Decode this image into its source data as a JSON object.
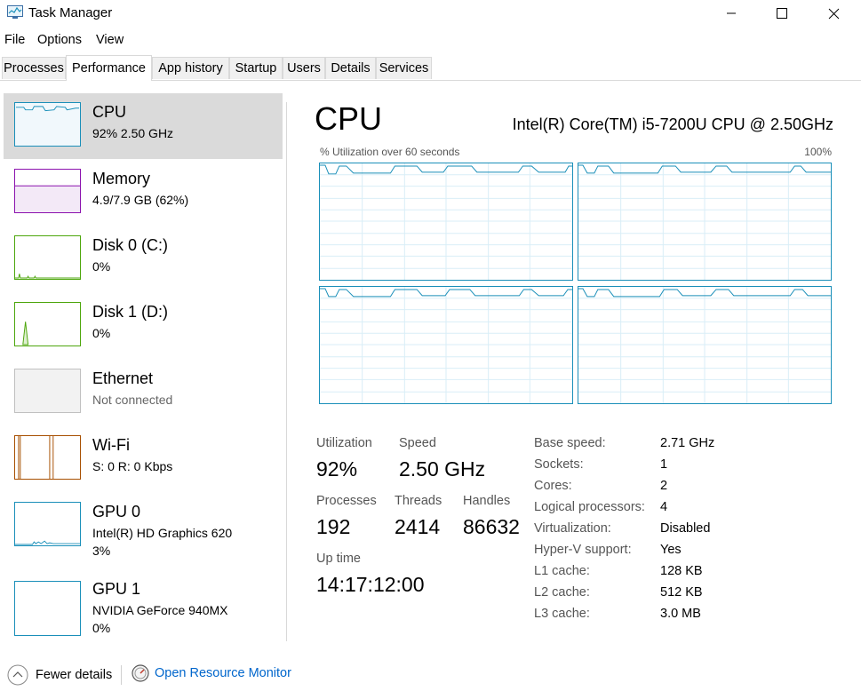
{
  "window": {
    "title": "Task Manager"
  },
  "menu": [
    "File",
    "Options",
    "View"
  ],
  "tabs": [
    "Processes",
    "Performance",
    "App history",
    "Startup",
    "Users",
    "Details",
    "Services"
  ],
  "active_tab": "Performance",
  "sidebar": [
    {
      "name": "CPU",
      "sub1": "92%  2.50 GHz",
      "color": "#1a8fb9",
      "selected": true
    },
    {
      "name": "Memory",
      "sub1": "4.9/7.9 GB (62%)",
      "color": "#8b12ae"
    },
    {
      "name": "Disk 0 (C:)",
      "sub1": "0%",
      "color": "#4da60c"
    },
    {
      "name": "Disk 1 (D:)",
      "sub1": "0%",
      "color": "#4da60c"
    },
    {
      "name": "Ethernet",
      "sub1": "Not connected",
      "color": "#c0c0c0"
    },
    {
      "name": "Wi-Fi",
      "sub1": "S: 0  R: 0 Kbps",
      "color": "#a74f01"
    },
    {
      "name": "GPU 0",
      "sub1": "Intel(R) HD Graphics 620",
      "sub2": "3%",
      "color": "#1a8fb9"
    },
    {
      "name": "GPU 1",
      "sub1": "NVIDIA GeForce 940MX",
      "sub2": "0%",
      "color": "#1a8fb9"
    }
  ],
  "main": {
    "title": "CPU",
    "model": "Intel(R) Core(TM) i5-7200U CPU @ 2.50GHz",
    "graph_label_left": "% Utilization over 60 seconds",
    "graph_label_right": "100%",
    "stats": {
      "utilization": {
        "label": "Utilization",
        "value": "92%"
      },
      "speed": {
        "label": "Speed",
        "value": "2.50 GHz"
      },
      "processes": {
        "label": "Processes",
        "value": "192"
      },
      "threads": {
        "label": "Threads",
        "value": "2414"
      },
      "handles": {
        "label": "Handles",
        "value": "86632"
      },
      "uptime": {
        "label": "Up time",
        "value": "14:17:12:00"
      }
    },
    "specs": [
      {
        "label": "Base speed:",
        "value": "2.71 GHz"
      },
      {
        "label": "Sockets:",
        "value": "1"
      },
      {
        "label": "Cores:",
        "value": "2"
      },
      {
        "label": "Logical processors:",
        "value": "4"
      },
      {
        "label": "Virtualization:",
        "value": "Disabled"
      },
      {
        "label": "Hyper-V support:",
        "value": "Yes"
      },
      {
        "label": "L1 cache:",
        "value": "128 KB"
      },
      {
        "label": "L2 cache:",
        "value": "512 KB"
      },
      {
        "label": "L3 cache:",
        "value": "3.0 MB"
      }
    ]
  },
  "footer": {
    "fewer_details": "Fewer details",
    "open_resource_monitor": "Open Resource Monitor"
  },
  "colors": {
    "accent": "#1a8fb9",
    "link": "#0066cc",
    "selected_bg": "#dadada"
  }
}
